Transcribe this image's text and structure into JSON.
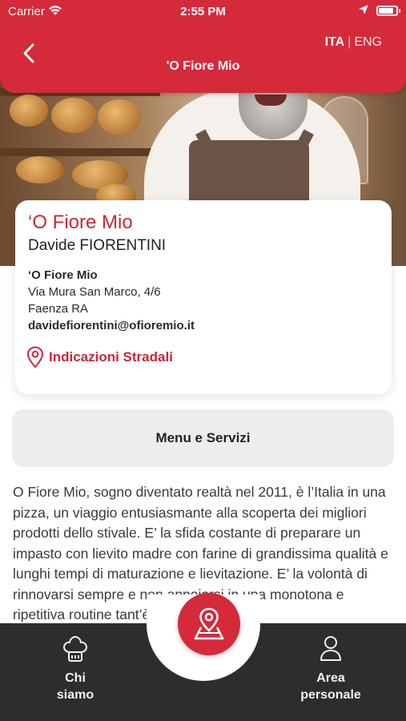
{
  "status_bar": {
    "carrier": "Carrier",
    "time": "2:55 PM"
  },
  "header": {
    "title": "'O Fiore Mio",
    "lang_active": "ITA",
    "lang_separator": "|",
    "lang_inactive": "ENG"
  },
  "card": {
    "business_name": "‘O Fiore Mio",
    "owner": "Davide FIORENTINI",
    "address_name": "‘O Fiore Mio",
    "street": "Via Mura San Marco, 4/6",
    "city": "Faenza RA",
    "email": "davidefiorentini@ofioremio.it",
    "directions_label": "Indicazioni Stradali"
  },
  "menu_button": {
    "label": "Menu e Servizi"
  },
  "description": "O Fiore Mio, sogno diventato realtà nel 2011, è l’Italia in una pizza, un viaggio entusiasmante alla scoperta dei migliori prodotti dello stivale. E’ la sfida costante di preparare un impasto con lievito madre con farine di grandissima qualità e lunghi tempi di maturazione e lievitazione. E’ la volontà di rinnovarsi sempre e non annoiarsi in una monotona e ripetitiva routine tant’è che",
  "tabbar": {
    "left_label_1": "Chi",
    "left_label_2": "siamo",
    "right_label_1": "Area",
    "right_label_2": "personale"
  },
  "colors": {
    "brand_red": "#d42a3a",
    "tabbar_bg": "#2d2d2d"
  },
  "icons": {
    "back": "chevron-left-icon",
    "directions": "location-pin-icon",
    "chi_siamo": "chef-hat-icon",
    "area_personale": "person-icon",
    "fab": "map-pin-icon"
  }
}
